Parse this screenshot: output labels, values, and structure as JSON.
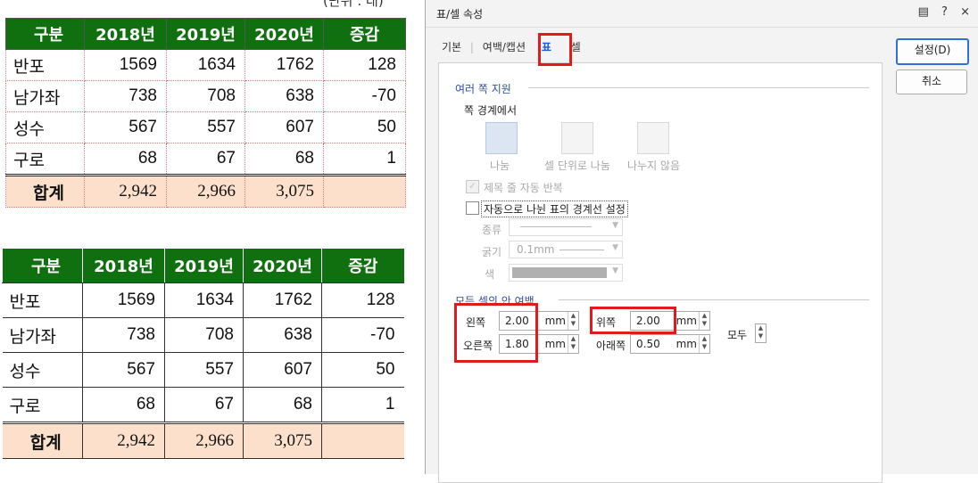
{
  "document": {
    "unit_note": "(단위 : 대)",
    "table1": {
      "headers": [
        "구분",
        "2018년",
        "2019년",
        "2020년",
        "증감"
      ],
      "rows": [
        [
          "반포",
          "1569",
          "1634",
          "1762",
          "128"
        ],
        [
          "남가좌",
          "738",
          "708",
          "638",
          "-70"
        ],
        [
          "성수",
          "567",
          "557",
          "607",
          "50"
        ],
        [
          "구로",
          "68",
          "67",
          "68",
          "1"
        ]
      ],
      "total": [
        "합계",
        "2,942",
        "2,966",
        "3,075",
        ""
      ]
    },
    "table2": {
      "headers": [
        "구분",
        "2018년",
        "2019년",
        "2020년",
        "증감"
      ],
      "rows": [
        [
          "반포",
          "1569",
          "1634",
          "1762",
          "128"
        ],
        [
          "남가좌",
          "738",
          "708",
          "638",
          "-70"
        ],
        [
          "성수",
          "567",
          "557",
          "607",
          "50"
        ],
        [
          "구로",
          "68",
          "67",
          "68",
          "1"
        ]
      ],
      "total": [
        "합계",
        "2,942",
        "2,966",
        "3,075",
        ""
      ]
    },
    "colors": {
      "header_bg": "#107010",
      "total_bg": "#fde0cc"
    }
  },
  "dialog": {
    "title": "표/셀 속성",
    "title_icons": [
      "comment-icon",
      "help-icon",
      "close-icon"
    ],
    "help_glyph": "?",
    "close_glyph": "×",
    "tabs": [
      "기본",
      "여백/캡션",
      "표",
      "셀"
    ],
    "active_tab": "표",
    "buttons": {
      "ok": "설정(D)",
      "cancel": "취소"
    },
    "multi_page": {
      "section_title": "여러 쪽 지원",
      "page_boundary_label": "쪽 경계에서",
      "options": [
        "나눔",
        "셀 단위로 나눔",
        "나누지 않음"
      ],
      "repeat_header": "제목 줄 자동 반복",
      "auto_border": "자동으로 나뉜 표의 경계선 설정",
      "type_label": "종류",
      "width_label": "굵기",
      "width_value": "0.1mm",
      "color_label": "색"
    },
    "cell_margin": {
      "section_title": "모든 셀의 안 여백",
      "left_label": "왼쪽",
      "left_value": "2.00",
      "right_label": "오른쪽",
      "right_value": "1.80",
      "top_label": "위쪽",
      "top_value": "2.00",
      "bottom_label": "아래쪽",
      "bottom_value": "0.50",
      "unit": "mm",
      "all_label": "모두"
    },
    "highlight_color": "#e21a1a"
  }
}
